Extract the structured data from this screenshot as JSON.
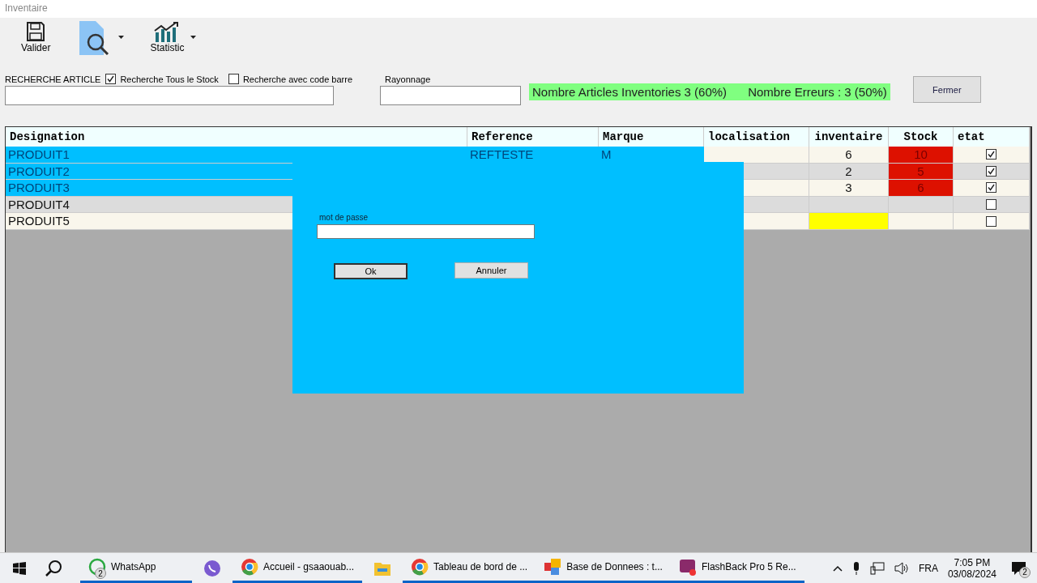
{
  "window": {
    "title": "Inventaire"
  },
  "toolbar": [
    {
      "kind": "save",
      "label": "Valider",
      "dropdown": false
    },
    {
      "kind": "search",
      "dropdown": true
    },
    {
      "kind": "chart",
      "label": "Statistic",
      "dropdown": true
    }
  ],
  "search": {
    "label": "RECHERCHE ARTICLE",
    "options": [
      {
        "label": "Recherche Tous le Stock",
        "checked": true
      },
      {
        "label": "Recherche avec code barre",
        "checked": false
      }
    ]
  },
  "rayonnage": {
    "label": "Rayonnage"
  },
  "summary": {
    "articles": "Nombre Articles Inventories 3 (60%)",
    "errors": "Nombre Erreurs : 3 (50%)"
  },
  "close_button": "Fermer",
  "table": {
    "columns": [
      "Designation",
      "Reference",
      "Marque",
      "localisation",
      "inventaire",
      "Stock",
      "etat"
    ],
    "rows": [
      {
        "selected": true,
        "designation": "PRODUIT1",
        "reference": "REFTESTE",
        "marque": "M",
        "inventaire": "6",
        "stock": "10",
        "stock_error": true,
        "missing": false,
        "checked": true
      },
      {
        "selected": true,
        "designation": "PRODUIT2",
        "inventaire": "2",
        "stock": "5",
        "stock_error": true,
        "missing": false,
        "checked": true
      },
      {
        "selected": true,
        "designation": "PRODUIT3",
        "inventaire": "3",
        "stock": "6",
        "stock_error": true,
        "missing": false,
        "checked": true
      },
      {
        "selected": false,
        "designation": "PRODUIT4",
        "stock_error": false,
        "missing": false,
        "checked": false
      },
      {
        "selected": false,
        "designation": "PRODUIT5",
        "stock_error": false,
        "missing": true,
        "checked": false
      }
    ]
  },
  "dialog": {
    "label": "mot de passe",
    "ok": "Ok",
    "cancel": "Annuler"
  },
  "taskbar": {
    "apps": [
      {
        "kind": "whatsapp",
        "label": "WhatsApp",
        "badge": "2",
        "running": true
      },
      {
        "kind": "viber",
        "running": false
      },
      {
        "kind": "chrome",
        "label": "Accueil - gsaaouab...",
        "running": true
      },
      {
        "kind": "folder",
        "running": false
      },
      {
        "kind": "chrome",
        "label": "Tableau de bord de ...",
        "running": true
      },
      {
        "kind": "db",
        "label": "Base de Donnees : t...",
        "running": true
      },
      {
        "kind": "recorder",
        "label": "FlashBack Pro 5 Re...",
        "running": true
      }
    ],
    "language": "FRA",
    "time": "7:05 PM",
    "date": "03/08/2024",
    "notifications": "2"
  }
}
